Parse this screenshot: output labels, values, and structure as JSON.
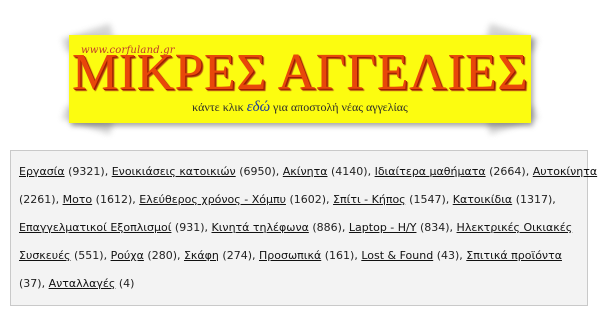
{
  "banner": {
    "site_tag": "www.corfuland.gr",
    "title": "ΜΙΚΡΕΣ ΑΓΓΕΛΙΕΣ",
    "sub_before": "κάντε κλικ ",
    "sub_link": "εδώ",
    "sub_after": " για αποστολή νέας αγγελίας",
    "colors": {
      "background": "#fcfc10",
      "title": "#e8470a",
      "link": "#1a3b9c"
    }
  },
  "categories": [
    {
      "label": "Εργασία",
      "count": "(9321)"
    },
    {
      "label": "Ενοικιάσεις κατοικιών",
      "count": "(6950)"
    },
    {
      "label": "Ακίνητα",
      "count": "(4140)"
    },
    {
      "label": "Ιδιαίτερα μαθήματα",
      "count": "(2664)"
    },
    {
      "label": "Αυτοκίνητα",
      "count": "(2261)"
    },
    {
      "label": "Μοτο",
      "count": "(1612)"
    },
    {
      "label": "Ελεύθερος χρόνος - Χόμπυ",
      "count": "(1602)"
    },
    {
      "label": "Σπίτι - Κήπος",
      "count": "(1547)"
    },
    {
      "label": "Κατοικίδια",
      "count": "(1317)"
    },
    {
      "label": "Επαγγελματικοί Εξοπλισμοί",
      "count": "(931)"
    },
    {
      "label": "Κινητά τηλέφωνα",
      "count": "(886)"
    },
    {
      "label": "Laptop - H/Y",
      "count": "(834)"
    },
    {
      "label": "Ηλεκτρικές Οικιακές Συσκευές",
      "count": "(551)"
    },
    {
      "label": "Ρούχα",
      "count": "(280)"
    },
    {
      "label": "Σκάφη",
      "count": "(274)"
    },
    {
      "label": "Προσωπικά",
      "count": "(161)"
    },
    {
      "label": "Lost & Found",
      "count": "(43)"
    },
    {
      "label": "Σπιτικά προϊόντα",
      "count": "(37)"
    },
    {
      "label": "Ανταλλαγές",
      "count": "(4)"
    }
  ],
  "separator": ","
}
